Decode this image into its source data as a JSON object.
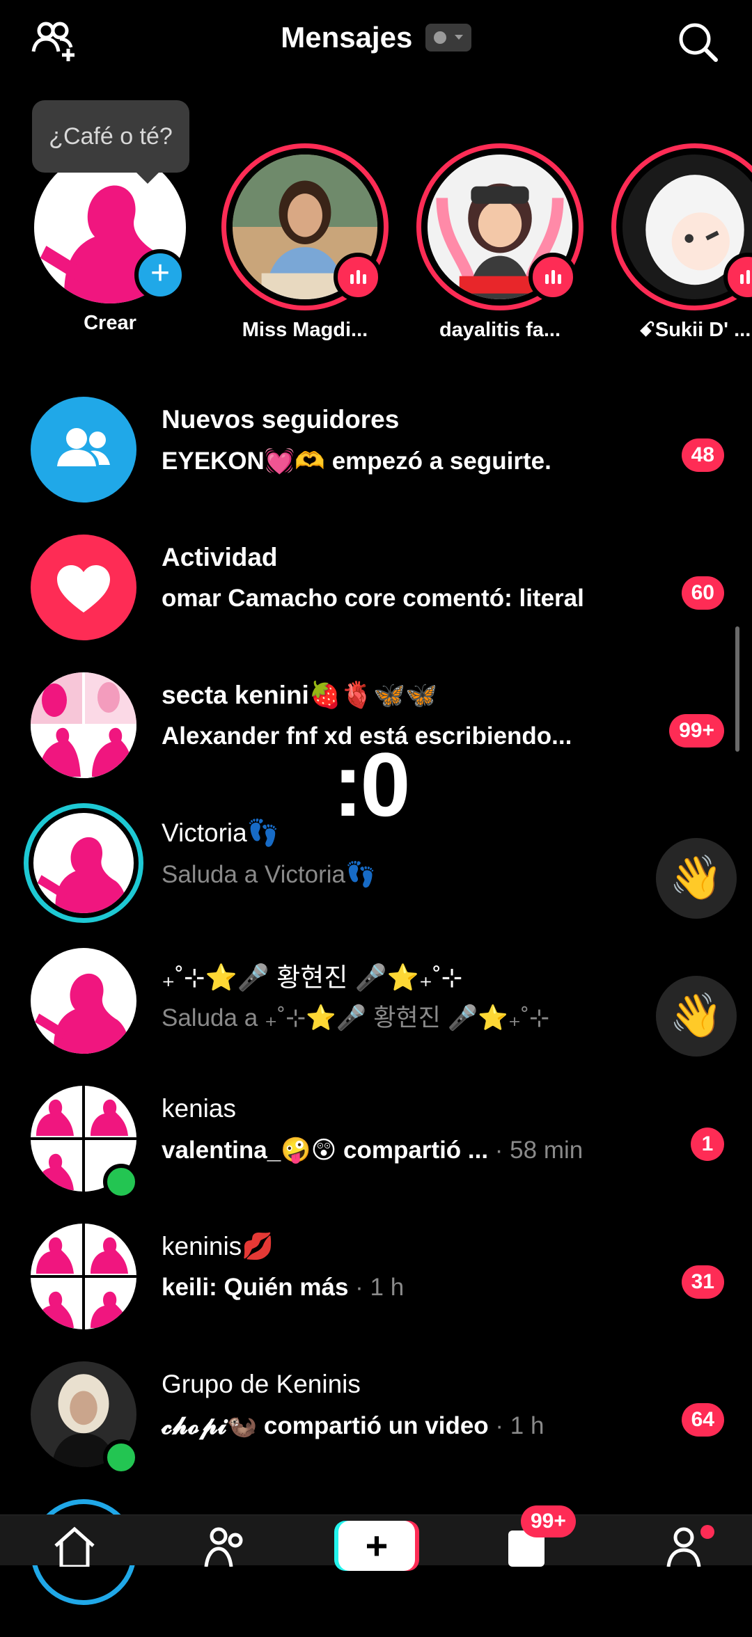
{
  "header": {
    "title": "Mensajes",
    "add_friend_icon": "add-friends-icon",
    "search_icon": "search-icon"
  },
  "tooltip": "¿Café o té?",
  "stories": [
    {
      "name": "Crear"
    },
    {
      "name": "Miss Magdi..."
    },
    {
      "name": "dayalitis fa..."
    },
    {
      "name": "ꗃSukii D' ..."
    }
  ],
  "rows": [
    {
      "title": "Nuevos seguidores",
      "subtitle": "EYEKON💓🫶 empezó a seguirte.",
      "badge": "48"
    },
    {
      "title": "Actividad",
      "subtitle": "omar Camacho core comentó: literal",
      "badge": "60"
    },
    {
      "title": "secta kenini🍓🫀🦋🦋",
      "subtitle": "Alexander fnf xd está escribiendo...",
      "badge": "99+"
    },
    {
      "title": "Victoria👣",
      "subtitle": "Saluda a Victoria👣",
      "action": "👋"
    },
    {
      "title": "₊˚⊹⭐🎤 황현진 🎤⭐₊˚⊹",
      "subtitle": "Saluda a ₊˚⊹⭐🎤 황현진 🎤⭐₊˚⊹",
      "action": "👋"
    },
    {
      "title": "kenias",
      "subtitle": "valentina_🤪😲 compartió ...",
      "time": " · 58 min",
      "badge": "1"
    },
    {
      "title": "keninis💋",
      "subtitle": "keili: Quién más",
      "time": " · 1 h",
      "badge": "31"
    },
    {
      "title": "Grupo de Keninis",
      "subtitle": "𝓬𝓱𝓸𝓹𝓲🦦 compartió un video",
      "time": " · 1 h",
      "badge": "64"
    }
  ],
  "overlay": ":0",
  "nav": {
    "create": "+",
    "inbox_badge": "99+"
  },
  "colors": {
    "accent": "#fe2c55",
    "followers": "#20a8e8",
    "online": "#23c552",
    "teal": "#25f4ee"
  }
}
